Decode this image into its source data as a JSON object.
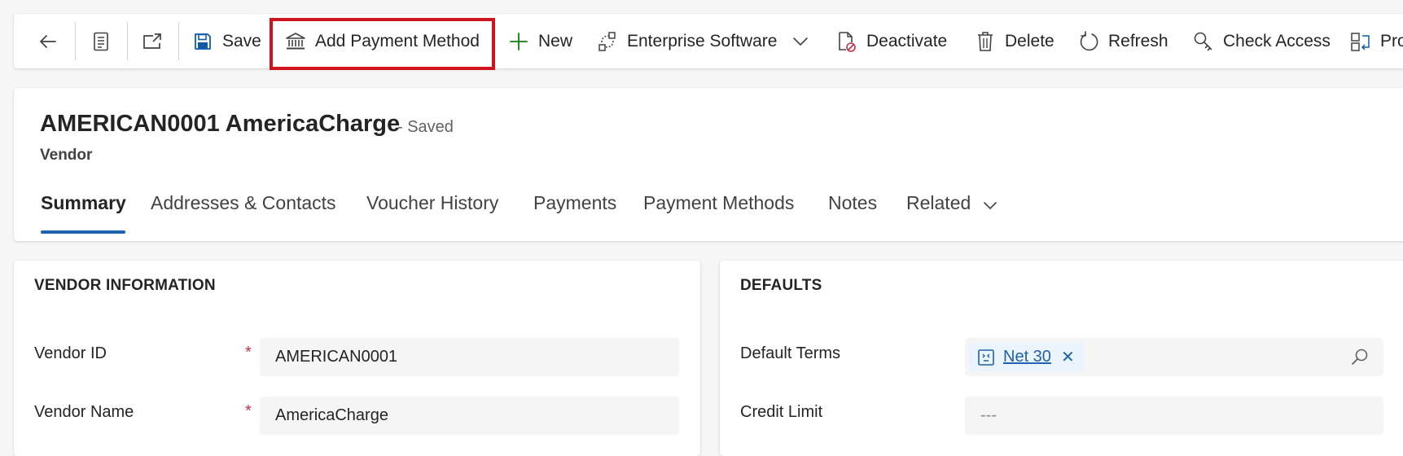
{
  "command_bar": {
    "save_label": "Save",
    "add_payment_label": "Add Payment Method",
    "new_label": "New",
    "enterprise_label": "Enterprise Software",
    "deactivate_label": "Deactivate",
    "delete_label": "Delete",
    "refresh_label": "Refresh",
    "check_access_label": "Check Access",
    "process_label": "Pro"
  },
  "record": {
    "title": "AMERICAN0001 AmericaCharge",
    "status": "- Saved",
    "entity": "Vendor"
  },
  "tabs": [
    {
      "label": "Summary"
    },
    {
      "label": "Addresses & Contacts"
    },
    {
      "label": "Voucher History"
    },
    {
      "label": "Payments"
    },
    {
      "label": "Payment Methods"
    },
    {
      "label": "Notes"
    },
    {
      "label": "Related"
    }
  ],
  "vendor_info": {
    "title": "VENDOR INFORMATION",
    "required_mark": "*",
    "fields": [
      {
        "label": "Vendor ID",
        "value": "AMERICAN0001"
      },
      {
        "label": "Vendor Name",
        "value": "AmericaCharge"
      }
    ]
  },
  "defaults": {
    "title": "DEFAULTS",
    "default_terms_label": "Default Terms",
    "default_terms_value": "Net 30",
    "remove_glyph": "✕",
    "credit_limit_label": "Credit Limit",
    "credit_limit_value": "---"
  },
  "colors": {
    "accent": "#1f62ad",
    "highlight": "#d1131d",
    "required": "#c4314b",
    "new_plus": "#107c10"
  }
}
